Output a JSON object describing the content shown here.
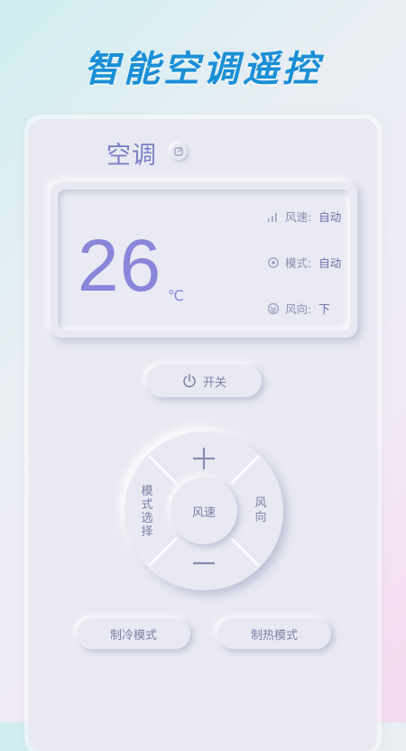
{
  "header": {
    "headline": "智能空调遥控"
  },
  "device": {
    "title": "空调"
  },
  "display": {
    "temperature": "26",
    "unit": "℃",
    "status": [
      {
        "label": "风速:",
        "value": "自动",
        "icon": "signal-bars-icon"
      },
      {
        "label": "模式:",
        "value": "自动",
        "icon": "mode-cycle-icon"
      },
      {
        "label": "风向:",
        "value": "下",
        "icon": "wind-direction-icon"
      }
    ]
  },
  "controls": {
    "power_label": "开关",
    "center_label": "风速",
    "mode_select_chars": [
      "模",
      "式",
      "选",
      "择"
    ],
    "wind_direction_chars": [
      "风",
      "向"
    ],
    "cool_mode_label": "制冷模式",
    "heat_mode_label": "制热模式"
  },
  "colors": {
    "accent": "#8a86da",
    "headline": "#1a8fd6",
    "panel": "#e8e9f2"
  }
}
